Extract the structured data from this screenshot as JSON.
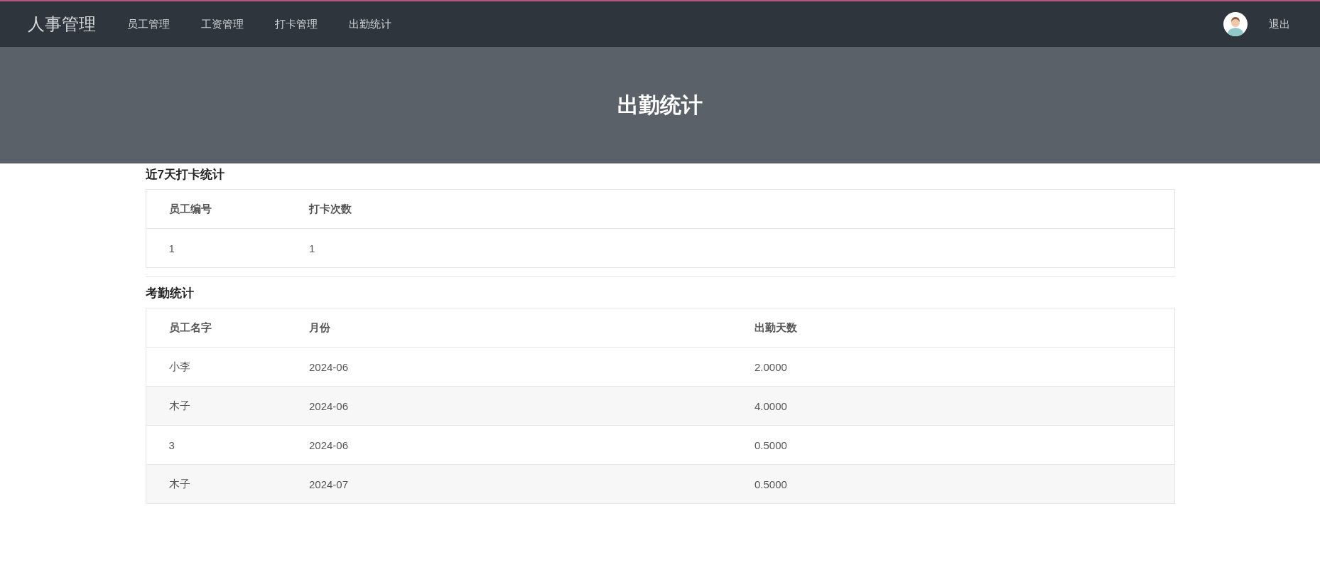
{
  "navbar": {
    "brand": "人事管理",
    "links": [
      {
        "label": "员工管理"
      },
      {
        "label": "工资管理"
      },
      {
        "label": "打卡管理"
      },
      {
        "label": "出勤统计"
      }
    ],
    "logout": "退出"
  },
  "hero": {
    "title": "出勤统计"
  },
  "sections": [
    {
      "title": "近7天打卡统计",
      "columns": [
        "员工编号",
        "打卡次数"
      ],
      "rows": [
        [
          "1",
          "1"
        ]
      ]
    },
    {
      "title": "考勤统计",
      "columns": [
        "员工名字",
        "月份",
        "出勤天数"
      ],
      "rows": [
        [
          "小李",
          "2024-06",
          "2.0000"
        ],
        [
          "木子",
          "2024-06",
          "4.0000"
        ],
        [
          "3",
          "2024-06",
          "0.5000"
        ],
        [
          "木子",
          "2024-07",
          "0.5000"
        ]
      ]
    }
  ]
}
